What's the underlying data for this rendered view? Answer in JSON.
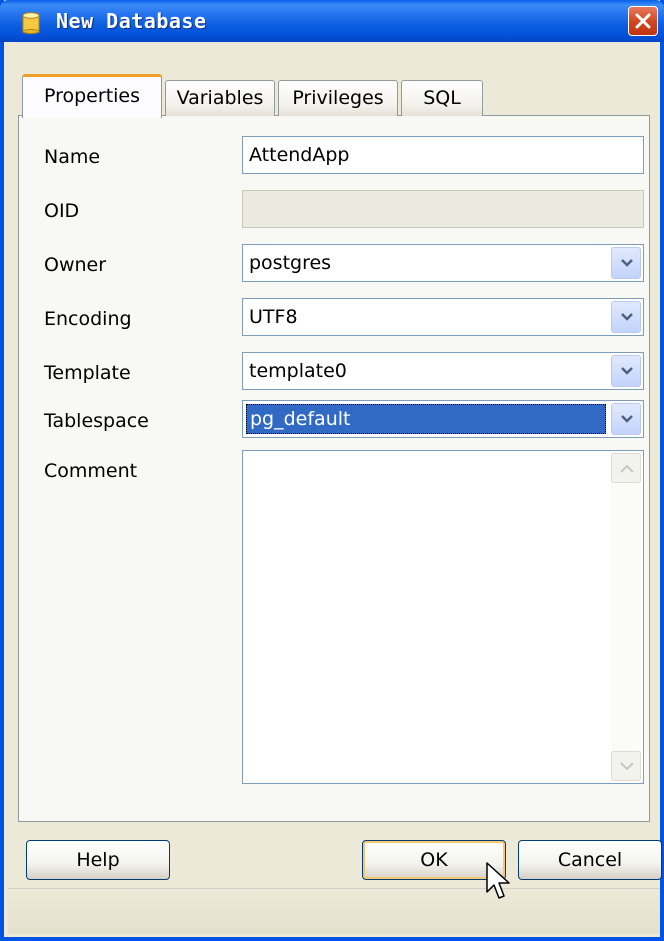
{
  "window": {
    "title": "New Database",
    "title_icon": "database-icon",
    "close_icon": "close-icon"
  },
  "tabs": [
    {
      "label": "Properties",
      "active": true
    },
    {
      "label": "Variables",
      "active": false
    },
    {
      "label": "Privileges",
      "active": false
    },
    {
      "label": "SQL",
      "active": false
    }
  ],
  "form": {
    "name": {
      "label": "Name",
      "value": "AttendApp"
    },
    "oid": {
      "label": "OID",
      "value": ""
    },
    "owner": {
      "label": "Owner",
      "value": "postgres"
    },
    "encoding": {
      "label": "Encoding",
      "value": "UTF8"
    },
    "template": {
      "label": "Template",
      "value": "template0"
    },
    "tablespace": {
      "label": "Tablespace",
      "value": "pg_default"
    },
    "comment": {
      "label": "Comment",
      "value": ""
    }
  },
  "buttons": {
    "help": "Help",
    "ok": "OK",
    "cancel": "Cancel"
  },
  "colors": {
    "title_bar": "#0a5fe0",
    "selection": "#316ac5",
    "close_button": "#d0441f",
    "active_tab_accent": "#f0a028"
  }
}
